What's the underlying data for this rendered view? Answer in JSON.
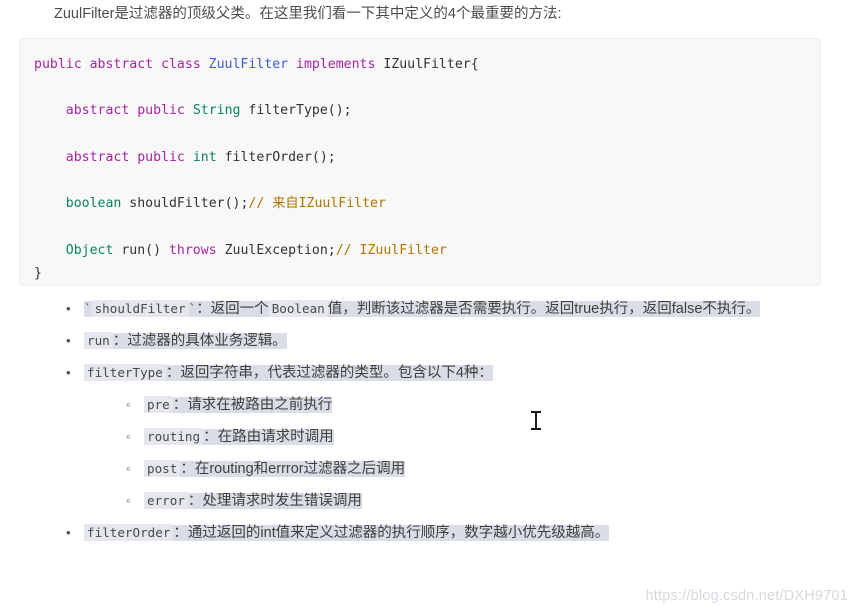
{
  "page": {
    "background_color": "#ffffff",
    "intro_paragraph": "ZuulFilter是过滤器的顶级父类。在这里我们看一下其中定义的4个最重要的方法:",
    "watermark": "https://blog.csdn.net/DXH9701"
  },
  "colors": {
    "code_background": "#f8f8f8",
    "code_border": "#eceef0",
    "keyword_purple": "#a626a4",
    "classname_blue": "#3b5bdb",
    "type_green": "#0b8457",
    "comment_orange": "#b37400",
    "plain_text": "#333333",
    "selection_highlight": "#d8dde6",
    "inline_code_background": "#e4e7eb",
    "body_text": "#4d4d4d",
    "watermark": "#d5d9de"
  },
  "code_block": {
    "language": "java",
    "lines": [
      {
        "tokens": [
          {
            "text": "public abstract class ",
            "cls": "kw"
          },
          {
            "text": "ZuulFilter ",
            "cls": "cls"
          },
          {
            "text": "implements ",
            "cls": "kw"
          },
          {
            "text": "IZuulFilter{",
            "cls": "pln"
          }
        ]
      },
      {
        "tokens": []
      },
      {
        "tokens": [
          {
            "text": "    ",
            "cls": "pln"
          },
          {
            "text": "abstract public ",
            "cls": "kw"
          },
          {
            "text": "String ",
            "cls": "typ"
          },
          {
            "text": "filterType();",
            "cls": "pln"
          }
        ]
      },
      {
        "tokens": []
      },
      {
        "tokens": [
          {
            "text": "    ",
            "cls": "pln"
          },
          {
            "text": "abstract public ",
            "cls": "kw"
          },
          {
            "text": "int ",
            "cls": "typ"
          },
          {
            "text": "filterOrder();",
            "cls": "pln"
          }
        ]
      },
      {
        "tokens": []
      },
      {
        "tokens": [
          {
            "text": "    ",
            "cls": "pln"
          },
          {
            "text": "boolean ",
            "cls": "typ"
          },
          {
            "text": "shouldFilter();",
            "cls": "pln"
          },
          {
            "text": "// 来自IZuulFilter",
            "cls": "cmt"
          }
        ]
      },
      {
        "tokens": []
      },
      {
        "tokens": [
          {
            "text": "    ",
            "cls": "pln"
          },
          {
            "text": "Object ",
            "cls": "typ"
          },
          {
            "text": "run() ",
            "cls": "pln"
          },
          {
            "text": "throws ",
            "cls": "kw"
          },
          {
            "text": "ZuulException;",
            "cls": "pln"
          },
          {
            "text": "// IZuulFilter",
            "cls": "cmt"
          }
        ]
      },
      {
        "tokens": [
          {
            "text": "}",
            "cls": "pln"
          }
        ]
      }
    ]
  },
  "bullets": {
    "marker_filled": "•",
    "marker_hollow": "◦",
    "items": [
      {
        "id": "shouldFilter",
        "code": "`shouldFilter`",
        "code_plain": "shouldFilter",
        "text": "：返回一个",
        "code2": "Boolean",
        "text2": "值，判断该过滤器是否需要执行。返回true执行，返回false不执行。"
      },
      {
        "id": "run",
        "code_plain": "run",
        "text": "：过滤器的具体业务逻辑。"
      },
      {
        "id": "filterType",
        "code_plain": "filterType",
        "text": "：返回字符串，代表过滤器的类型。包含以下4种：",
        "children": [
          {
            "id": "pre",
            "code_plain": "pre",
            "text": "：请求在被路由之前执行"
          },
          {
            "id": "routing",
            "code_plain": "routing",
            "text": "：在路由请求时调用"
          },
          {
            "id": "post",
            "code_plain": "post",
            "text": "：在routing和errror过滤器之后调用"
          },
          {
            "id": "error",
            "code_plain": "error",
            "text": "：处理请求时发生错误调用"
          }
        ]
      },
      {
        "id": "filterOrder",
        "code_plain": "filterOrder",
        "text": "：通过返回的int值来定义过滤器的执行顺序，数字越小优先级越高。"
      }
    ]
  }
}
